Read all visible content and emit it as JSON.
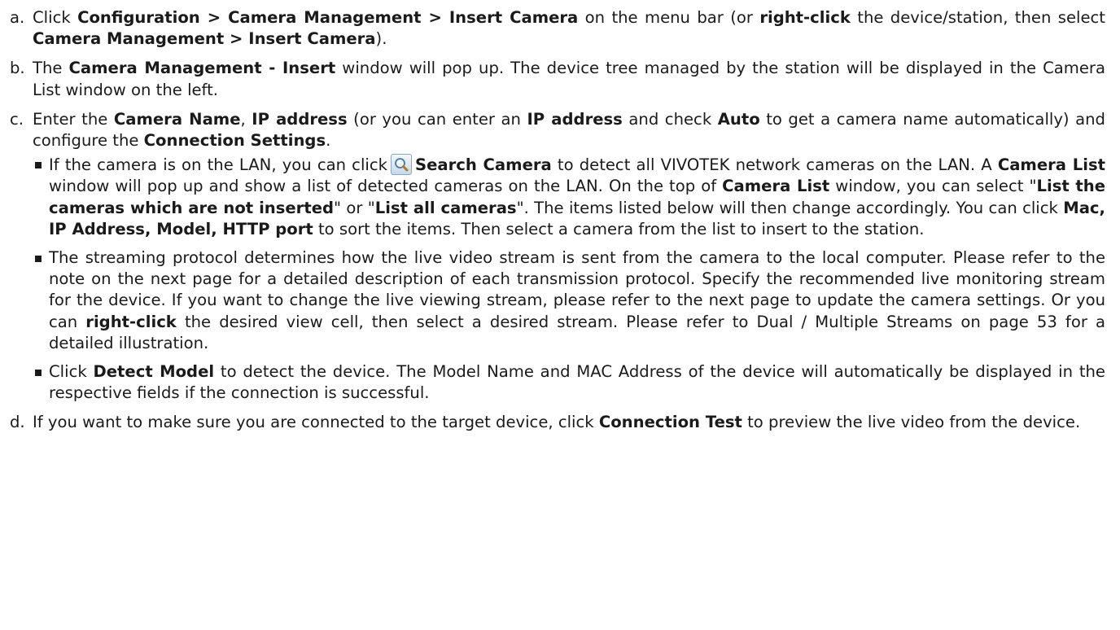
{
  "step_a": {
    "label": "a.",
    "t1": "Click ",
    "b1": "Configuration > Camera Management > Insert Camera",
    "t2": " on the menu bar (or ",
    "b2": "right-click",
    "t3": " the device/station, then select ",
    "b3": "Camera Management > Insert Camera",
    "t4": ")."
  },
  "step_b": {
    "label": "b.",
    "t1": "The ",
    "b1": "Camera Management - Insert",
    "t2": " window will pop up. The device tree managed by the station will be displayed in the Camera List window on the left."
  },
  "step_c": {
    "label": "c.",
    "t1": "Enter the ",
    "b1": "Camera Name",
    "t2": ", ",
    "b2": "IP address",
    "t3": " (or you can enter an ",
    "b3": "IP address",
    "t4": " and check ",
    "b4": "Auto",
    "t5": " to get a camera name automatically) and configure the ",
    "b5": "Connection Settings",
    "t6": "."
  },
  "bullet_1": {
    "t1": "If the camera is on the LAN, you can click",
    "icon": "magnifier-icon",
    "b1": "Search Camera",
    "t2": " to detect all VIVOTEK network cameras on the LAN. A ",
    "b2": "Camera List",
    "t3": " window will pop up and show a list of detected cameras on the LAN. On the top of ",
    "b3": "Camera List",
    "t4": " window, you can select \"",
    "b4": "List the cameras which are not inserted",
    "t5": "\" or \"",
    "b5": "List all cameras",
    "t6": "\". The items listed below will then change accordingly. You can click ",
    "b6": "Mac, IP Address, Model, HTTP port",
    "t7": " to sort the items. Then select a camera from the list to insert to the station."
  },
  "bullet_2": {
    "t1": "The streaming protocol determines how the live video stream is sent from the camera to the local computer. Please refer to the note on the next page for a detailed description of each transmission protocol. Specify the recommended live monitoring stream for the device. If you want to change the live viewing stream, please refer to the next page to update the camera settings. Or you can ",
    "b1": "right-click",
    "t2": " the desired view cell, then select a desired stream. Please refer to Dual / Multiple Streams on page 53 for a detailed illustration."
  },
  "bullet_3": {
    "t1": "Click ",
    "b1": "Detect Model",
    "t2": " to detect the device. The Model Name and MAC Address of the device will automatically be displayed in the respective fields if the connection is successful."
  },
  "step_d": {
    "label": "d.",
    "t1": "If you want to make sure you are connected to the target device, click ",
    "b1": "Connection Test",
    "t2": " to preview the live video from the device."
  },
  "colors": {
    "text": "#1a1a1a",
    "icon_border": "#8aa8c6",
    "icon_fill": "#c8d8ea"
  }
}
